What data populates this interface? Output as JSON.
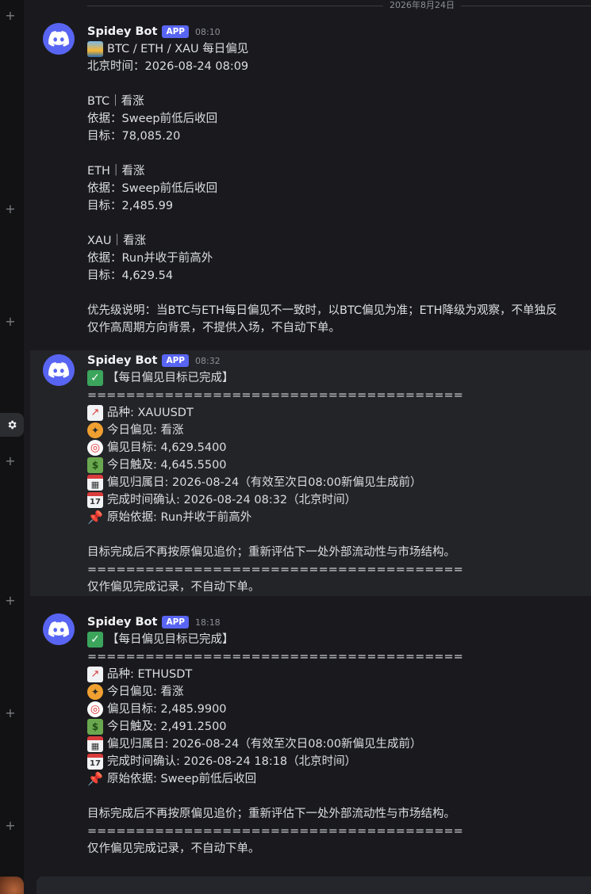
{
  "date_divider": "2026年8月24日",
  "bot": {
    "name": "Spidey Bot",
    "badge": "APP"
  },
  "messages": [
    {
      "time": "08:10",
      "title_icon": "sunrise-icon",
      "title": "BTC / ETH / XAU 每日偏见",
      "beijing_time": "北京时间：2026-08-24 08:09",
      "btc": {
        "head": "BTC｜看涨",
        "basis": "依据：Sweep前低后收回",
        "target": "目标：78,085.20"
      },
      "eth": {
        "head": "ETH｜看涨",
        "basis": "依据：Sweep前低后收回",
        "target": "目标：2,485.99"
      },
      "xau": {
        "head": "XAU｜看涨",
        "basis": "依据：Run并收于前高外",
        "target": "目标：4,629.54"
      },
      "priority_note": "优先级说明：当BTC与ETH每日偏见不一致时，以BTC偏见为准；ETH降级为观察，不单独反",
      "note2": "仅作高周期方向背景，不提供入场，不自动下单。"
    },
    {
      "time": "08:32",
      "title": "【每日偏见目标已完成】",
      "separator": "=======================================",
      "symbol": "品种: XAUUSDT",
      "bias": "今日偏见: 看涨",
      "bias_target": "偏见目标: 4,629.5400",
      "touched": "今日触及: 4,645.5500",
      "bias_date": "偏见归属日: 2026-08-24（有效至次日08:00新偏见生成前）",
      "confirm_time": "完成时间确认: 2026-08-24 08:32（北京时间）",
      "basis": "原始依据: Run并收于前高外",
      "after_note": "目标完成后不再按原偏见追价；重新评估下一处外部流动性与市场结构。",
      "footer": "仅作偏见完成记录，不自动下单。"
    },
    {
      "time": "18:18",
      "title": "【每日偏见目标已完成】",
      "separator": "=======================================",
      "symbol": "品种: ETHUSDT",
      "bias": "今日偏见: 看涨",
      "bias_target": "偏见目标: 2,485.9900",
      "touched": "今日触及: 2,491.2500",
      "bias_date": "偏见归属日: 2026-08-24（有效至次日08:00新偏见生成前）",
      "confirm_time": "完成时间确认: 2026-08-24 18:18（北京时间）",
      "basis": "原始依据: Sweep前低后收回",
      "after_note": "目标完成后不再按原偏见追价；重新评估下一处外部流动性与市场结构。",
      "footer": "仅作偏见完成记录，不自动下单。"
    }
  ],
  "icons": {
    "check": "white-check-mark-icon",
    "chart": "chart-increasing-icon",
    "compass": "compass-icon",
    "target": "direct-hit-icon",
    "money": "dollar-banknote-icon",
    "calendar": "calendar-icon",
    "cal17": "calendar-17-icon",
    "pin": "pushpin-icon"
  },
  "colors": {
    "blurple": "#5865f2",
    "background": "#1a1a1e",
    "highlight": "#232428"
  }
}
